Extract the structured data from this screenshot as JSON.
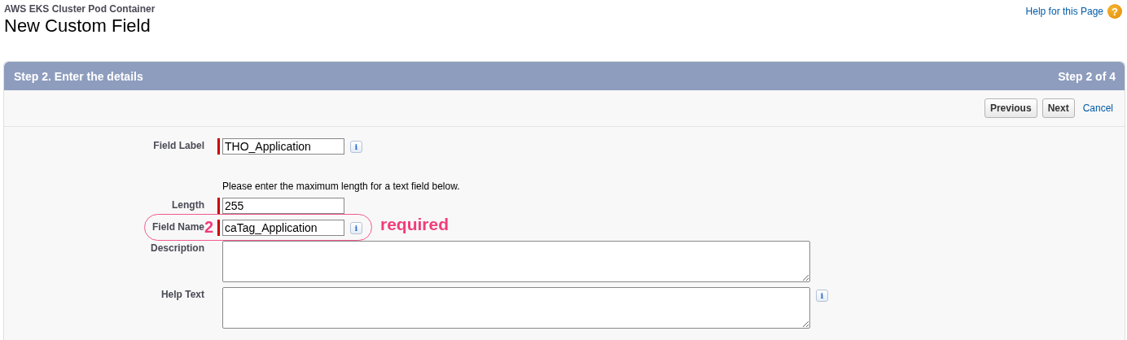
{
  "breadcrumb": "AWS EKS Cluster Pod Container",
  "title": "New Custom Field",
  "help_link": {
    "label": "Help for this Page",
    "icon": "?"
  },
  "wizard": {
    "step_title": "Step 2. Enter the details",
    "step_counter": "Step 2 of 4",
    "buttons": [
      {
        "label": "Previous",
        "kind": "button"
      },
      {
        "label": "Next",
        "kind": "button"
      },
      {
        "label": "Cancel",
        "kind": "link"
      }
    ],
    "rows": [
      {
        "kind": "input",
        "label": "Field Label",
        "value": "THO_Application",
        "required": true,
        "info": "i"
      },
      {
        "kind": "note",
        "text": "Please enter the maximum length for a text field below."
      },
      {
        "kind": "input",
        "label": "Length",
        "value": "255",
        "required": true
      },
      {
        "kind": "input",
        "label": "Field Name",
        "value": "caTag_Application",
        "required": true,
        "info": "i",
        "annotation": {
          "number": "2",
          "note": "required"
        }
      },
      {
        "kind": "textarea",
        "label": "Description",
        "required": false
      },
      {
        "kind": "textarea",
        "label": "Help Text",
        "required": false,
        "info": "i"
      }
    ]
  }
}
